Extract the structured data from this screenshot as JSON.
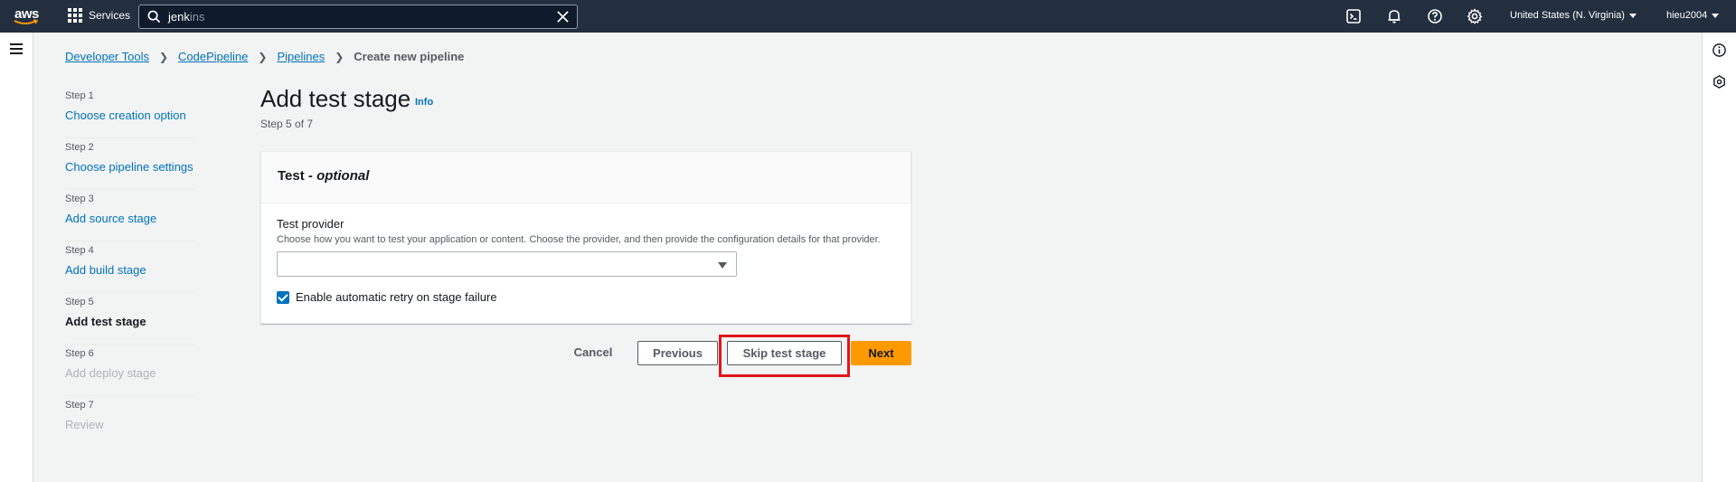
{
  "topnav": {
    "logo_text": "aws",
    "services_label": "Services",
    "search_value_typed": "jenk",
    "search_value_ghost": "ins",
    "region_label": "United States (N. Virginia)",
    "user_label": "hieu2004",
    "icons": [
      "cloudshell-icon",
      "bell-icon",
      "help-icon",
      "settings-icon"
    ]
  },
  "breadcrumb": {
    "items": [
      "Developer Tools",
      "CodePipeline",
      "Pipelines"
    ],
    "current": "Create new pipeline"
  },
  "steps": [
    {
      "num": "Step 1",
      "label": "Choose creation option",
      "state": "link"
    },
    {
      "num": "Step 2",
      "label": "Choose pipeline settings",
      "state": "link"
    },
    {
      "num": "Step 3",
      "label": "Add source stage",
      "state": "link"
    },
    {
      "num": "Step 4",
      "label": "Add build stage",
      "state": "link"
    },
    {
      "num": "Step 5",
      "label": "Add test stage",
      "state": "active"
    },
    {
      "num": "Step 6",
      "label": "Add deploy stage",
      "state": "disabled"
    },
    {
      "num": "Step 7",
      "label": "Review",
      "state": "disabled"
    }
  ],
  "main": {
    "title": "Add test stage",
    "info_label": "Info",
    "subtitle": "Step 5 of 7",
    "panel": {
      "title_main": "Test",
      "title_optional": " - optional",
      "field_label": "Test provider",
      "field_description": "Choose how you want to test your application or content. Choose the provider, and then provide the configuration details for that provider.",
      "select_value": "",
      "checkbox_label": "Enable automatic retry on stage failure",
      "checkbox_checked": true
    }
  },
  "actions": {
    "cancel": "Cancel",
    "previous": "Previous",
    "skip": "Skip test stage",
    "next": "Next"
  },
  "colors": {
    "nav_bg": "#232f3e",
    "link": "#0073bb",
    "primary_button": "#ff9900",
    "highlight": "#e3141c"
  }
}
